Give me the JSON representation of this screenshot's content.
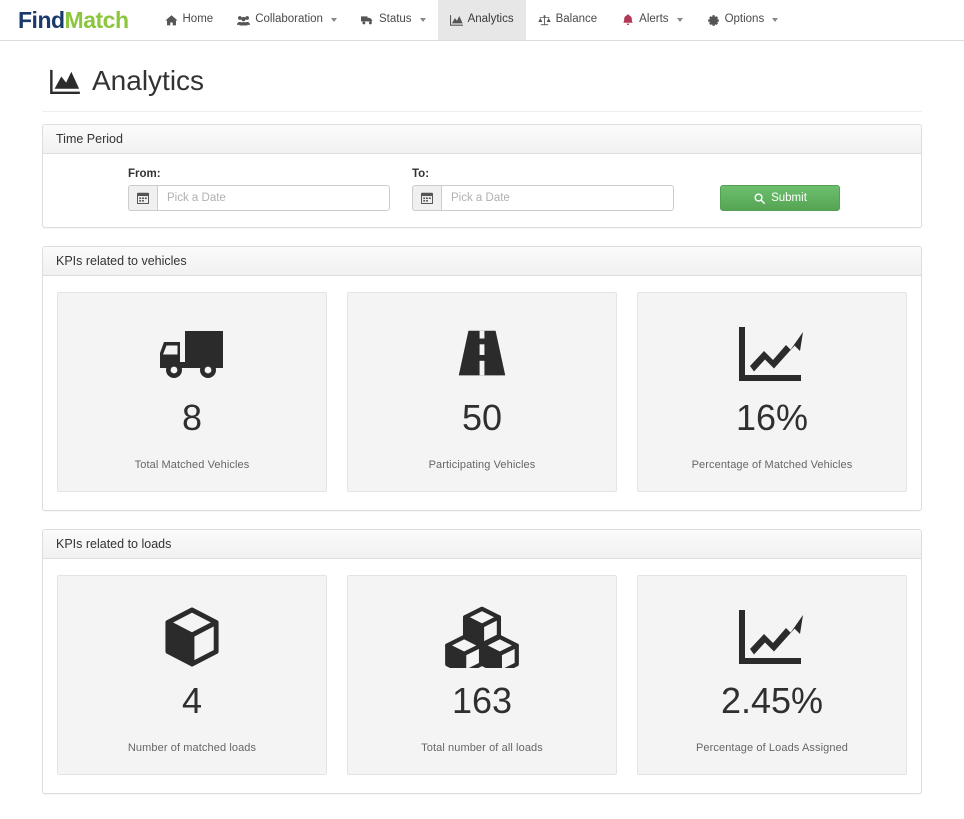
{
  "brand": {
    "part1": "Find",
    "part2": "Match",
    "color1": "#1b3a6b",
    "color2": "#8cc63e"
  },
  "nav": {
    "items": [
      {
        "label": "Home",
        "icon": "home-icon",
        "caret": false,
        "active": false
      },
      {
        "label": "Collaboration",
        "icon": "users-icon",
        "caret": true,
        "active": false
      },
      {
        "label": "Status",
        "icon": "truck-status-icon",
        "caret": true,
        "active": false
      },
      {
        "label": "Analytics",
        "icon": "area-chart-icon",
        "caret": false,
        "active": true
      },
      {
        "label": "Balance",
        "icon": "balance-scale-icon",
        "caret": false,
        "active": false
      },
      {
        "label": "Alerts",
        "icon": "bell-icon",
        "caret": true,
        "active": false
      },
      {
        "label": "Options",
        "icon": "gear-icon",
        "caret": true,
        "active": false
      }
    ],
    "alert_icon_color": "#b03a55"
  },
  "page": {
    "title": "Analytics",
    "icon": "area-chart-icon"
  },
  "time_period": {
    "heading": "Time Period",
    "from": {
      "label": "From:",
      "value": "",
      "placeholder": "Pick a Date",
      "icon": "calendar-icon"
    },
    "to": {
      "label": "To:",
      "value": "",
      "placeholder": "Pick a Date",
      "icon": "calendar-icon"
    },
    "submit": {
      "label": "Submit",
      "icon": "search-icon",
      "color": "#5cb85c"
    }
  },
  "vehicles_panel": {
    "heading": "KPIs related to vehicles",
    "cards": [
      {
        "icon": "truck-icon",
        "value": "8",
        "label": "Total Matched Vehicles"
      },
      {
        "icon": "road-icon",
        "value": "50",
        "label": "Participating Vehicles"
      },
      {
        "icon": "line-chart-arrow-icon",
        "value": "16%",
        "label": "Percentage of Matched Vehicles"
      }
    ]
  },
  "loads_panel": {
    "heading": "KPIs related to loads",
    "cards": [
      {
        "icon": "cube-icon",
        "value": "4",
        "label": "Number of matched loads"
      },
      {
        "icon": "cubes-icon",
        "value": "163",
        "label": "Total number of all loads"
      },
      {
        "icon": "line-chart-arrow-icon",
        "value": "2.45%",
        "label": "Percentage of Loads Assigned"
      }
    ]
  }
}
